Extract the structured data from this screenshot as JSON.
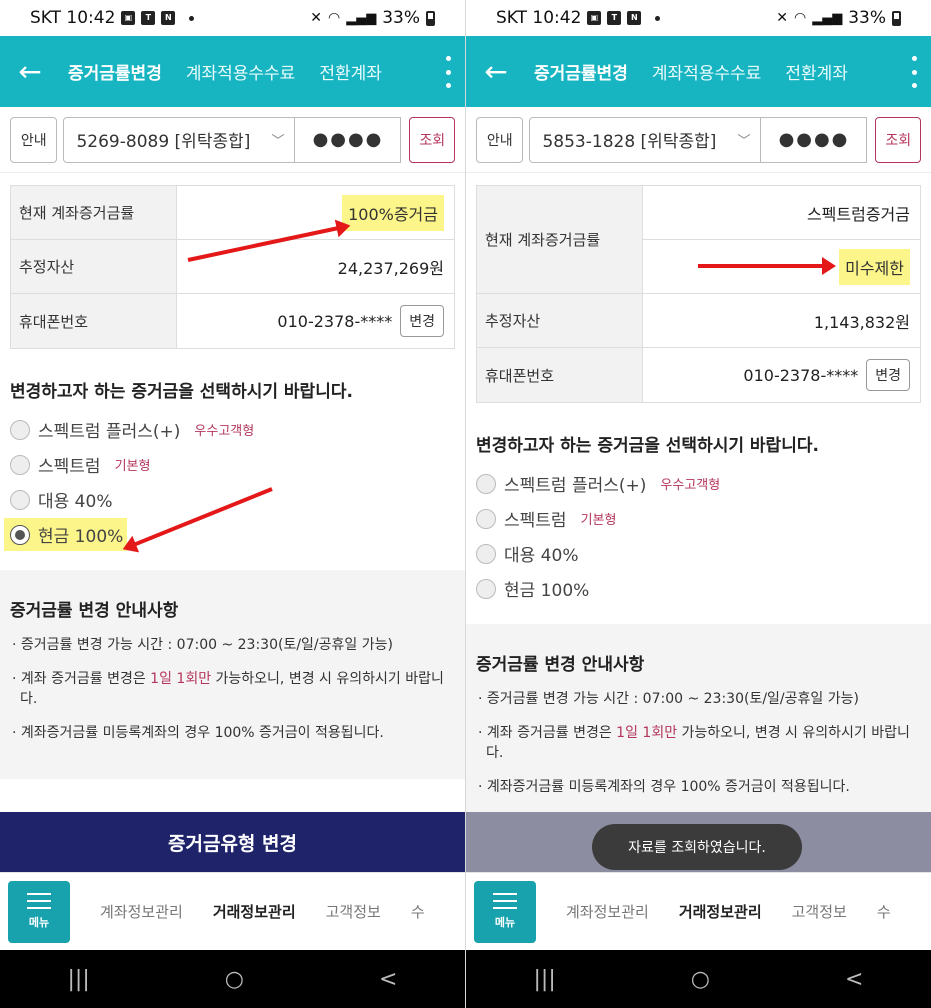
{
  "status": {
    "carrier_time": "SKT 10:42",
    "battery": "33%"
  },
  "appbar": {
    "tabs": [
      "증거금률변경",
      "계좌적용수수료",
      "전환계좌"
    ]
  },
  "left": {
    "guide": "안내",
    "account": "5269-8089 [위탁종합]",
    "password": "●●●●",
    "query": "조회",
    "rows": {
      "rate_label": "현재 계좌증거금률",
      "rate_value": "100%증거금",
      "asset_label": "추정자산",
      "asset_value": "24,237,269원",
      "phone_label": "휴대폰번호",
      "phone_value": "010-2378-****",
      "change_btn": "변경"
    },
    "select_title": "변경하고자 하는 증거금을 선택하시기 바랍니다.",
    "options": [
      {
        "label": "스펙트럼 플러스(+)",
        "tag": "우수고객형"
      },
      {
        "label": "스펙트럼",
        "tag": "기본형"
      },
      {
        "label": "대용 40%",
        "tag": ""
      },
      {
        "label": "현금 100%",
        "tag": ""
      }
    ],
    "notice_title": "증거금률 변경 안내사항",
    "notice1": "· 증거금률 변경 가능 시간 : 07:00 ~ 23:30(토/일/공휴일 가능)",
    "notice2a": "· 계좌 증거금률 변경은 ",
    "notice2b": "1일 1회만",
    "notice2c": " 가능하오니, 변경 시 유의하시기 바랍니다.",
    "notice3": "· 계좌증거금률 미등록계좌의 경우 100% 증거금이 적용됩니다.",
    "bigbtn": "증거금유형 변경"
  },
  "right": {
    "guide": "안내",
    "account": "5853-1828 [위탁종합]",
    "password": "●●●●",
    "query": "조회",
    "rows": {
      "rate_label": "현재 계좌증거금률",
      "rate_value1": "스펙트럼증거금",
      "rate_value2": "미수제한",
      "asset_label": "추정자산",
      "asset_value": "1,143,832원",
      "phone_label": "휴대폰번호",
      "phone_value": "010-2378-****",
      "change_btn": "변경"
    },
    "select_title": "변경하고자 하는 증거금을 선택하시기 바랍니다.",
    "options": [
      {
        "label": "스펙트럼 플러스(+)",
        "tag": "우수고객형"
      },
      {
        "label": "스펙트럼",
        "tag": "기본형"
      },
      {
        "label": "대용 40%",
        "tag": ""
      },
      {
        "label": "현금 100%",
        "tag": ""
      }
    ],
    "notice_title": "증거금률 변경 안내사항",
    "notice1": "· 증거금률 변경 가능 시간 : 07:00 ~ 23:30(토/일/공휴일 가능)",
    "notice2a": "· 계좌 증거금률 변경은 ",
    "notice2b": "1일 1회만",
    "notice2c": " 가능하오니, 변경 시 유의하시기 바랍니다.",
    "notice3": "· 계좌증거금률 미등록계좌의 경우 100% 증거금이 적용됩니다.",
    "toast": "자료를 조회하였습니다."
  },
  "bottomnav": {
    "menu": "메뉴",
    "items": [
      "계좌정보관리",
      "거래정보관리",
      "고객정보",
      "수"
    ]
  },
  "sysnav": {
    "recent": "|||",
    "home": "○",
    "back": "<"
  }
}
